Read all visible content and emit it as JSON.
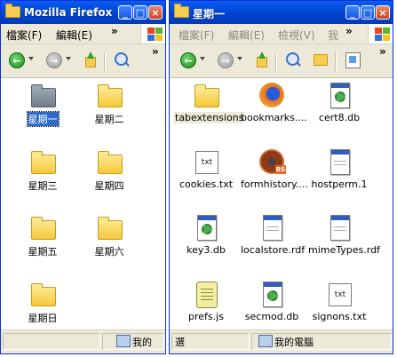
{
  "left_window": {
    "title": "Mozilla Firefox",
    "menu": [
      "檔案(F)",
      "編輯(E)"
    ],
    "status_text": "我的",
    "items": [
      {
        "label": "星期一",
        "icon": "folder-gray",
        "selected": true
      },
      {
        "label": "星期二",
        "icon": "folder"
      },
      {
        "label": "星期三",
        "icon": "folder"
      },
      {
        "label": "星期四",
        "icon": "folder"
      },
      {
        "label": "星期五",
        "icon": "folder"
      },
      {
        "label": "星期六",
        "icon": "folder"
      },
      {
        "label": "星期日",
        "icon": "folder"
      }
    ]
  },
  "right_window": {
    "title": "星期一",
    "menu": [
      "檔案(F)",
      "編輯(E)",
      "檢視(V)",
      "我"
    ],
    "status_left": "選",
    "status_text": "我的電腦",
    "items": [
      {
        "label": "tabextensions",
        "icon": "folder",
        "highlight": true
      },
      {
        "label": "bookmarks....",
        "icon": "firefox-doc"
      },
      {
        "label": "cert8.db",
        "icon": "db-gear"
      },
      {
        "label": "cookies.txt",
        "icon": "txt"
      },
      {
        "label": "formhistory....",
        "icon": "formhistory"
      },
      {
        "label": "hostperm.1",
        "icon": "window-doc"
      },
      {
        "label": "key3.db",
        "icon": "db-gear"
      },
      {
        "label": "localstore.rdf",
        "icon": "window-doc"
      },
      {
        "label": "mimeTypes.rdf",
        "icon": "window-doc"
      },
      {
        "label": "prefs.js",
        "icon": "script"
      },
      {
        "label": "secmod.db",
        "icon": "db-gear"
      },
      {
        "label": "signons.txt",
        "icon": "txt"
      }
    ]
  },
  "icons": {
    "title_buttons": [
      "minimize-icon",
      "maximize-icon",
      "close-icon"
    ],
    "toolbar": [
      "back-icon",
      "forward-icon",
      "up-folder-icon",
      "search-icon",
      "folders-icon",
      "views-icon"
    ]
  },
  "colors": {
    "titlebar": "#0054e3",
    "selection": "#316ac5",
    "chrome": "#ece9d8"
  },
  "glyphs": {
    "minimize": "_",
    "maximize": "□",
    "close": "×",
    "chevron": "»",
    "back": "←",
    "forward": "→",
    "txt": "txt",
    "formhistory_badge": "BS"
  }
}
